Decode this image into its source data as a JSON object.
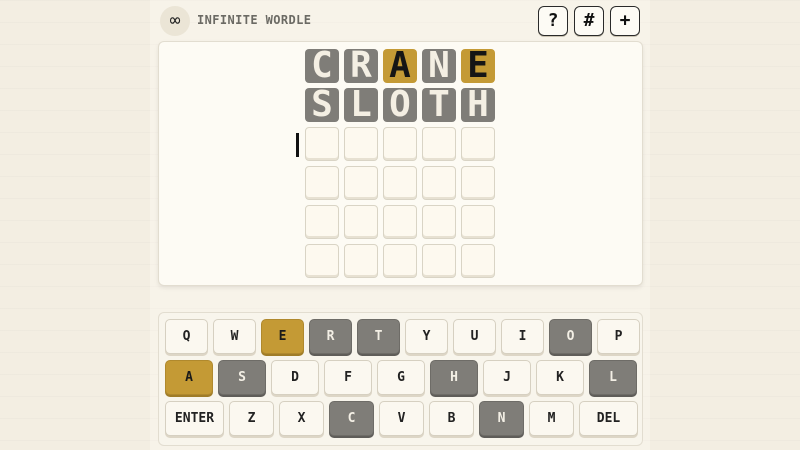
{
  "header": {
    "logo_glyph": "∞",
    "title": "INFINITE WORDLE",
    "help_label": "?",
    "stats_label": "#",
    "new_label": "+"
  },
  "board": {
    "rows": [
      [
        {
          "l": "C",
          "s": "gray"
        },
        {
          "l": "R",
          "s": "gray"
        },
        {
          "l": "A",
          "s": "gold"
        },
        {
          "l": "N",
          "s": "gray"
        },
        {
          "l": "E",
          "s": "gold"
        }
      ],
      [
        {
          "l": "S",
          "s": "gray"
        },
        {
          "l": "L",
          "s": "gray"
        },
        {
          "l": "O",
          "s": "gray"
        },
        {
          "l": "T",
          "s": "gray"
        },
        {
          "l": "H",
          "s": "gray"
        }
      ],
      [
        {
          "l": "",
          "s": "empty"
        },
        {
          "l": "",
          "s": "empty"
        },
        {
          "l": "",
          "s": "empty"
        },
        {
          "l": "",
          "s": "empty"
        },
        {
          "l": "",
          "s": "empty"
        }
      ],
      [
        {
          "l": "",
          "s": "empty"
        },
        {
          "l": "",
          "s": "empty"
        },
        {
          "l": "",
          "s": "empty"
        },
        {
          "l": "",
          "s": "empty"
        },
        {
          "l": "",
          "s": "empty"
        }
      ],
      [
        {
          "l": "",
          "s": "empty"
        },
        {
          "l": "",
          "s": "empty"
        },
        {
          "l": "",
          "s": "empty"
        },
        {
          "l": "",
          "s": "empty"
        },
        {
          "l": "",
          "s": "empty"
        }
      ],
      [
        {
          "l": "",
          "s": "empty"
        },
        {
          "l": "",
          "s": "empty"
        },
        {
          "l": "",
          "s": "empty"
        },
        {
          "l": "",
          "s": "empty"
        },
        {
          "l": "",
          "s": "empty"
        }
      ]
    ]
  },
  "keyboard": {
    "rows": [
      [
        {
          "k": "Q",
          "s": ""
        },
        {
          "k": "W",
          "s": ""
        },
        {
          "k": "E",
          "s": "gold"
        },
        {
          "k": "R",
          "s": "gray"
        },
        {
          "k": "T",
          "s": "gray"
        },
        {
          "k": "Y",
          "s": ""
        },
        {
          "k": "U",
          "s": ""
        },
        {
          "k": "I",
          "s": ""
        },
        {
          "k": "O",
          "s": "gray"
        },
        {
          "k": "P",
          "s": ""
        }
      ],
      [
        {
          "k": "A",
          "s": "gold"
        },
        {
          "k": "S",
          "s": "gray"
        },
        {
          "k": "D",
          "s": ""
        },
        {
          "k": "F",
          "s": ""
        },
        {
          "k": "G",
          "s": ""
        },
        {
          "k": "H",
          "s": "gray"
        },
        {
          "k": "J",
          "s": ""
        },
        {
          "k": "K",
          "s": ""
        },
        {
          "k": "L",
          "s": "gray"
        }
      ],
      [
        {
          "k": "ENTER",
          "s": ""
        },
        {
          "k": "Z",
          "s": ""
        },
        {
          "k": "X",
          "s": ""
        },
        {
          "k": "C",
          "s": "gray"
        },
        {
          "k": "V",
          "s": ""
        },
        {
          "k": "B",
          "s": ""
        },
        {
          "k": "N",
          "s": "gray"
        },
        {
          "k": "M",
          "s": ""
        },
        {
          "k": "DEL",
          "s": ""
        }
      ]
    ]
  },
  "colors": {
    "absent": "#7f7d78",
    "present": "#c49a35",
    "background": "#f3eee2"
  }
}
